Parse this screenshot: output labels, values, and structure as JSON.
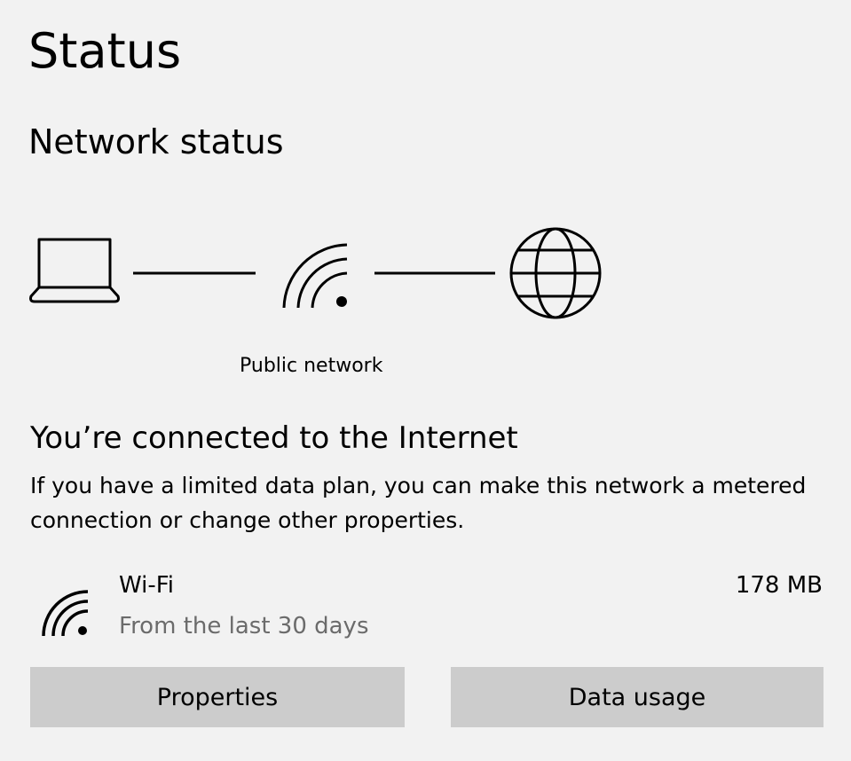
{
  "header": {
    "title": "Status",
    "subtitle": "Network status"
  },
  "diagram": {
    "nodes": [
      {
        "icon": "laptop-icon"
      },
      {
        "icon": "wifi-icon",
        "label": "Public network"
      },
      {
        "icon": "globe-icon"
      }
    ]
  },
  "connection": {
    "headline": "You’re connected to the Internet",
    "description": "If you have a limited data plan, you can make this network a metered connection or change other properties."
  },
  "adapter": {
    "icon": "wifi-icon",
    "name": "Wi-Fi",
    "period": "From the last 30 days",
    "usage": "178 MB"
  },
  "buttons": {
    "properties": "Properties",
    "data_usage": "Data usage"
  },
  "colors": {
    "background": "#f2f2f2",
    "button": "#cccccc",
    "secondary_text": "#6b6b6b"
  }
}
